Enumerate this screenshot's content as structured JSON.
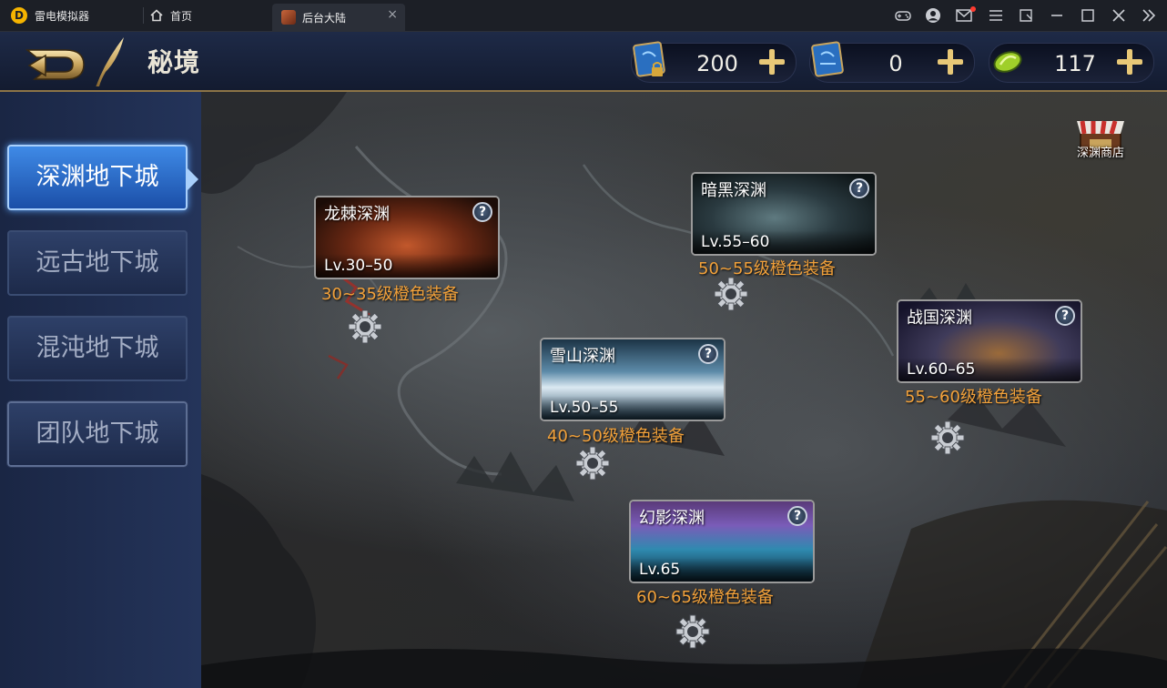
{
  "emulator": {
    "app_name": "雷电模拟器",
    "home_label": "首页",
    "tab_label": "后台大陆",
    "tab_close": "×"
  },
  "header": {
    "title": "秘境",
    "resources": [
      {
        "icon": "locked-ticket-icon",
        "value": "200"
      },
      {
        "icon": "ticket-icon",
        "value": "0"
      },
      {
        "icon": "coin-icon",
        "value": "117"
      }
    ]
  },
  "sidebar": {
    "items": [
      {
        "label": "深渊地下城",
        "active": true
      },
      {
        "label": "远古地下城",
        "active": false
      },
      {
        "label": "混沌地下城",
        "active": false
      },
      {
        "label": "团队地下城",
        "active": false
      }
    ]
  },
  "map": {
    "shop_label": "深渊商店",
    "dungeons": [
      {
        "name": "龙棘深渊",
        "level": "Lv.30–50",
        "reward": "30~35级橙色装备",
        "theme": "fire"
      },
      {
        "name": "暗黑深渊",
        "level": "Lv.55–60",
        "reward": "50~55级橙色装备",
        "theme": "dark"
      },
      {
        "name": "雪山深渊",
        "level": "Lv.50–55",
        "reward": "40~50级橙色装备",
        "theme": "snow"
      },
      {
        "name": "战国深渊",
        "level": "Lv.60–65",
        "reward": "55~60级橙色装备",
        "theme": "war"
      },
      {
        "name": "幻影深渊",
        "level": "Lv.65",
        "reward": "60~65级橙色装备",
        "theme": "phantom"
      }
    ]
  },
  "colors": {
    "accent_gold": "#8c7447",
    "reward_orange": "#f2a13a",
    "active_tab": "#3f8ae6"
  }
}
